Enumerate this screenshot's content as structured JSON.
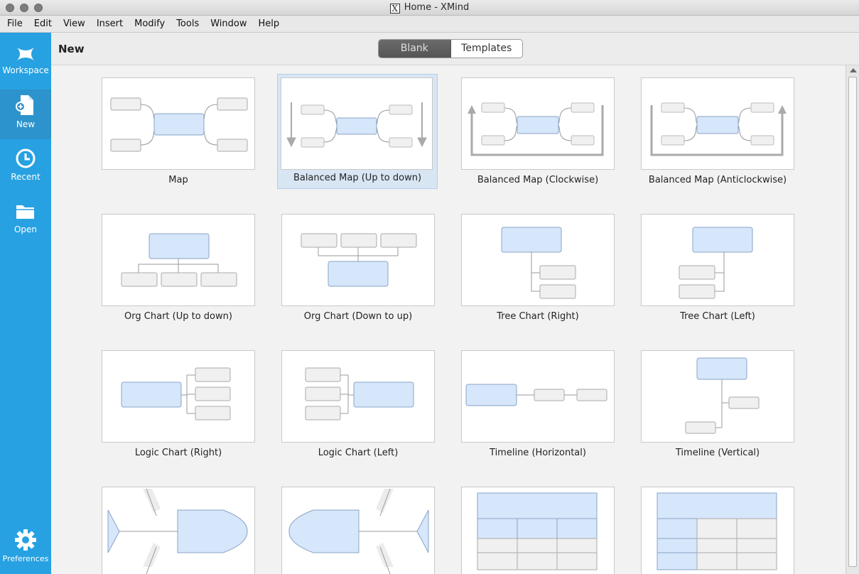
{
  "window": {
    "title": "Home - XMind",
    "app_icon_glyph": "X"
  },
  "menu": [
    "File",
    "Edit",
    "View",
    "Insert",
    "Modify",
    "Tools",
    "Window",
    "Help"
  ],
  "sidebar": {
    "items": [
      {
        "label": "Workspace",
        "icon": "xmind-logo-icon"
      },
      {
        "label": "New",
        "icon": "new-document-icon"
      },
      {
        "label": "Recent",
        "icon": "clock-icon"
      },
      {
        "label": "Open",
        "icon": "folder-icon"
      }
    ],
    "preferences": {
      "label": "Preferences",
      "icon": "gear-icon"
    }
  },
  "header": {
    "title": "New",
    "tabs": [
      {
        "label": "Blank"
      },
      {
        "label": "Templates"
      }
    ],
    "active_tab": "Blank"
  },
  "templates": [
    {
      "label": "Map"
    },
    {
      "label": "Balanced Map (Up to down)"
    },
    {
      "label": "Balanced Map (Clockwise)"
    },
    {
      "label": "Balanced Map (Anticlockwise)"
    },
    {
      "label": "Org Chart (Up to down)"
    },
    {
      "label": "Org Chart (Down to up)"
    },
    {
      "label": "Tree Chart (Right)"
    },
    {
      "label": "Tree Chart (Left)"
    },
    {
      "label": "Logic Chart (Right)"
    },
    {
      "label": "Logic Chart (Left)"
    },
    {
      "label": "Timeline (Horizontal)"
    },
    {
      "label": "Timeline (Vertical)"
    },
    {
      "label": ""
    },
    {
      "label": ""
    },
    {
      "label": ""
    },
    {
      "label": ""
    }
  ],
  "selected_template": "Balanced Map (Up to down)",
  "colors": {
    "sidebar": "#27a1e1",
    "central_topic": "#d6e6fb",
    "subtopic": "#f0f0f0",
    "selection": "#d8e6f4"
  }
}
